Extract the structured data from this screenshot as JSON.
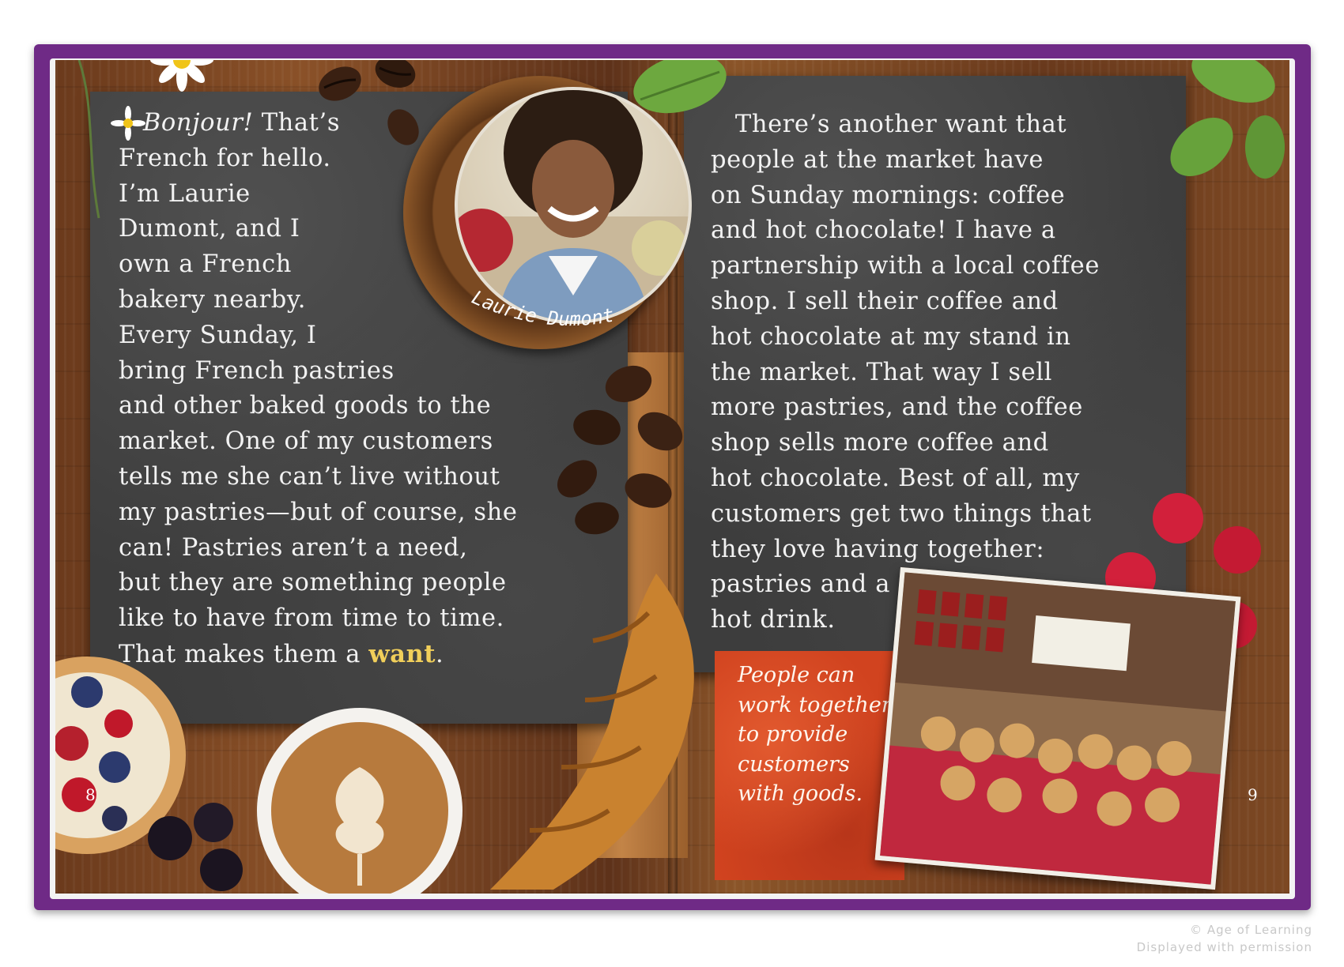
{
  "left_page": {
    "lines": [
      "Bonjour! That’s",
      "French for hello.",
      "I’m Laurie",
      "Dumont, and I",
      "own a French",
      "bakery nearby.",
      "Every Sunday, I",
      "bring French pastries",
      "and other baked goods to the",
      "market. One of my customers",
      "tells me she can’t live without",
      "my pastries—but of course, she",
      "can! Pastries aren’t a need,",
      "but they are something people",
      "like to have from time to time.",
      "That makes them a want."
    ],
    "page_number": "8"
  },
  "portrait": {
    "name": "Laurie Dumont"
  },
  "right_page": {
    "lines": [
      "There’s another want that",
      "people at the market have",
      "on Sunday mornings: coffee",
      "and hot chocolate! I have a",
      "partnership with a local coffee",
      "shop. I sell their coffee and",
      "hot chocolate at my stand in",
      "the market. That way I sell",
      "more pastries, and the coffee",
      "shop sells more coffee and",
      "hot chocolate. Best of all, my",
      "customers get two things that",
      "they love having together:",
      "pastries and a",
      "hot drink."
    ],
    "page_number": "9"
  },
  "callout": {
    "lines": [
      "People can",
      "work together",
      "to provide",
      "customers",
      "with goods."
    ]
  },
  "credits": {
    "line1": "© Age of Learning",
    "line2": "Displayed with permission"
  },
  "colors": {
    "book_cover": "#6f2a86",
    "chalkboard": "#3d3d3d",
    "highlight": "#f1cf5a",
    "callout_bg": "#d1431f"
  }
}
